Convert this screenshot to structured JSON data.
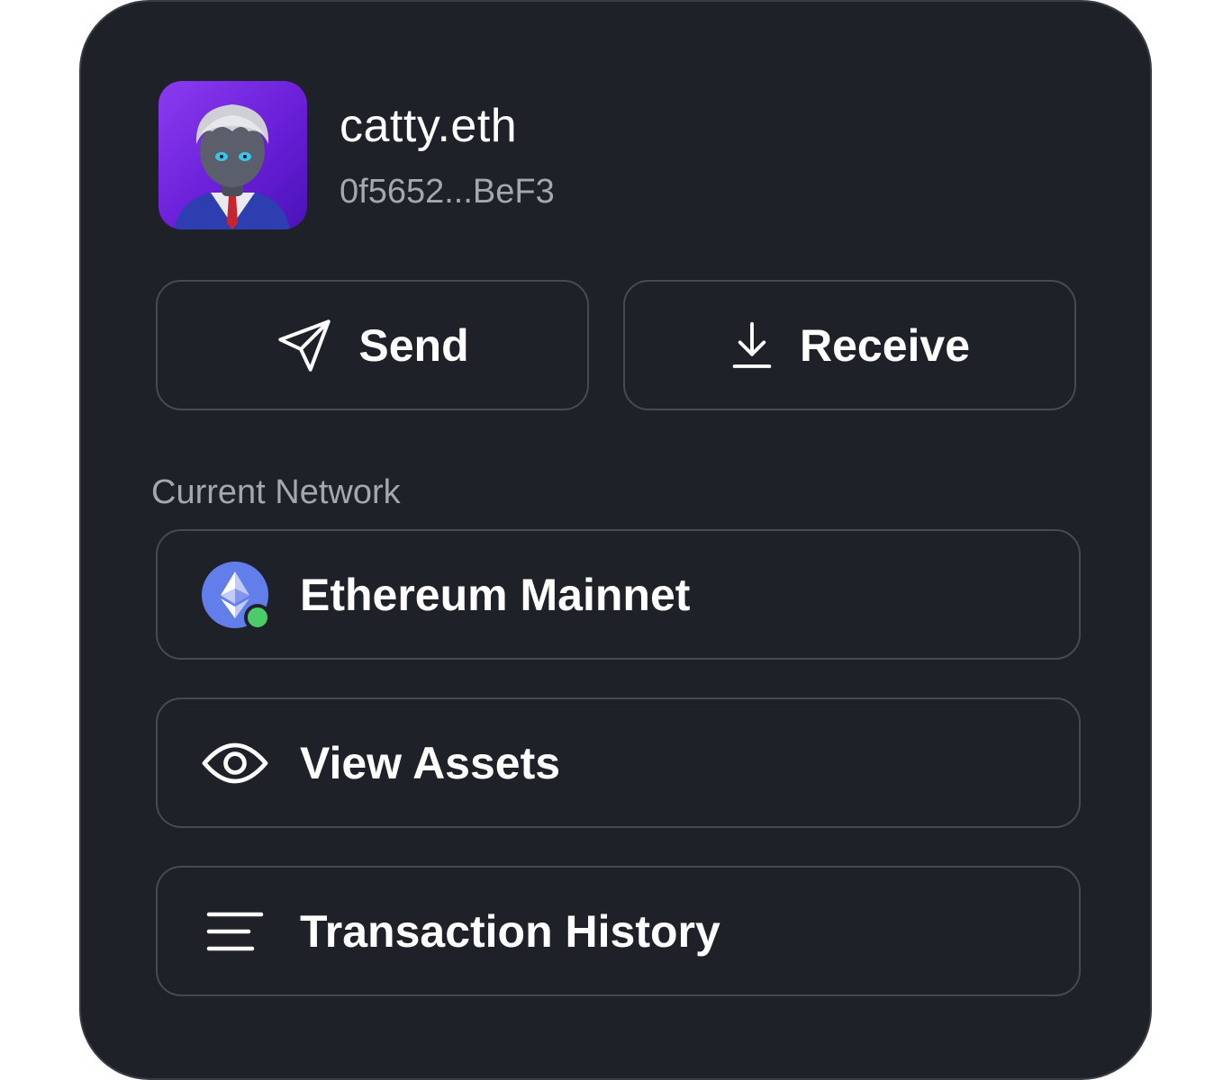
{
  "profile": {
    "name": "catty.eth",
    "address": "0f5652...BeF3"
  },
  "actions": {
    "send_label": "Send",
    "receive_label": "Receive"
  },
  "network": {
    "section_label": "Current Network",
    "name": "Ethereum Mainnet",
    "status": "connected",
    "status_color": "#4ccb6b",
    "icon_color": "#627eea"
  },
  "menu": {
    "view_assets_label": "View Assets",
    "transaction_history_label": "Transaction History"
  },
  "colors": {
    "panel_bg": "#1f2128",
    "border": "#474a52",
    "text_primary": "#ffffff",
    "text_secondary": "#a4a7ae",
    "avatar_bg": "#7a2ee6"
  }
}
